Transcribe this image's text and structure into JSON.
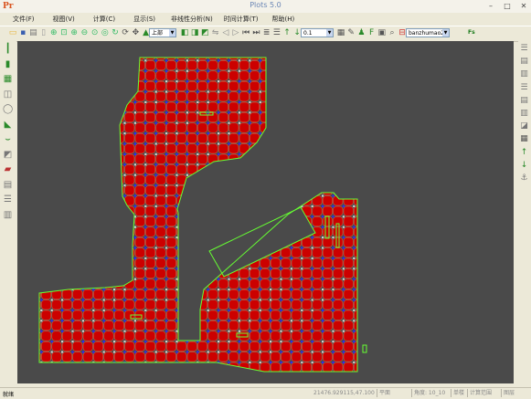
{
  "window": {
    "title": "Plots 5.0",
    "logo": "Pr",
    "minimize": "–",
    "maximize": "□",
    "close": "✕"
  },
  "menu": [
    "文件(F)",
    "视图(V)",
    "计算(C)",
    "显示(S)",
    "非线性分析(N)",
    "时间计算(T)",
    "帮助(H)"
  ],
  "toolbar": {
    "floor_select": "上部",
    "scale_select": "0.1",
    "name_select": "banzhumao2",
    "fs_label": "Fs"
  },
  "status": {
    "ready": "就绪",
    "coords": "21476.929115,47.100",
    "cells": [
      "平面",
      "角度: 10_10",
      "单楼",
      "计算范围",
      "图层"
    ]
  },
  "colors": {
    "background": "#4a4a4a",
    "panel_fill": "#cc0000",
    "outline": "#66ff33",
    "node": "#2a2aff",
    "cross": "#ff7a50"
  },
  "icons": {
    "toolbar": [
      "open-icon",
      "save-icon",
      "print-icon",
      "page-icon",
      "zoom-in-icon",
      "zoom-fit-icon",
      "zoom-plus-icon",
      "zoom-minus-icon",
      "zoom-window-icon",
      "zoom-prev-icon",
      "refresh-icon",
      "rotate-icon",
      "pan-icon",
      "view-3d-icon",
      "view-front-icon",
      "view-side-icon",
      "view-iso-icon",
      "mirror-icon",
      "previous-icon",
      "next-icon",
      "first-icon",
      "last-icon",
      "layers-icon",
      "stack-icon",
      "arrow-up-icon",
      "arrow-down-icon",
      "table-icon",
      "edit-icon",
      "person-icon",
      "fs-icon",
      "image-icon",
      "search-icon",
      "scale-icon"
    ],
    "left": [
      "column-icon",
      "beam-icon",
      "slab-icon",
      "wall-icon",
      "load-icon",
      "support-icon",
      "section-icon",
      "mesh-icon",
      "brick-icon",
      "grid-icon",
      "report-icon",
      "result-icon"
    ],
    "right": [
      "report-icon",
      "grid-icon",
      "result-icon",
      "report-icon",
      "grid-icon",
      "result-icon",
      "chart-icon",
      "table-icon",
      "arrow-up-icon",
      "arrow-down-icon",
      "anchor-icon"
    ]
  }
}
